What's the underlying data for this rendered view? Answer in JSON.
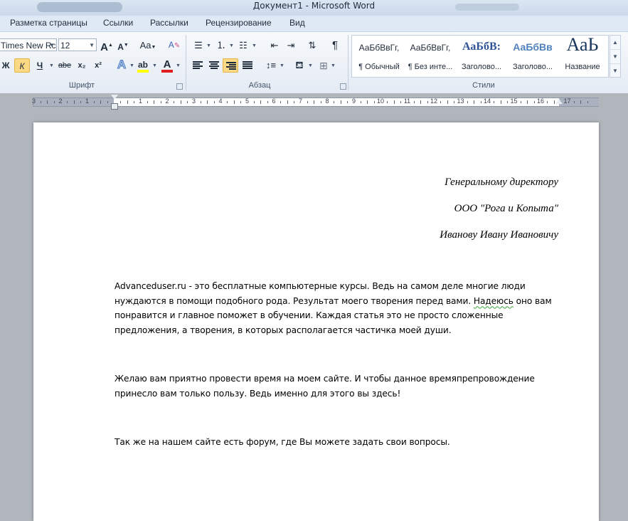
{
  "window": {
    "title": "Документ1  -  Microsoft Word"
  },
  "tabs": [
    "Разметка страницы",
    "Ссылки",
    "Рассылки",
    "Рецензирование",
    "Вид"
  ],
  "ribbon": {
    "font_group": {
      "label": "Шрифт",
      "font_name": "Times New Rc",
      "font_size": "12",
      "grow_label": "A",
      "shrink_label": "A",
      "case_label": "Aa",
      "bold_label": "Ж",
      "italic_label": "К",
      "underline_label": "Ч",
      "strike_label": "abe",
      "subscript_label": "x₂",
      "superscript_label": "x²",
      "effects_label": "A",
      "highlight_label": "ab",
      "font_color_label": "A",
      "highlight_color": "#ffff00",
      "font_color": "#e02020"
    },
    "paragraph_group": {
      "label": "Абзац"
    },
    "styles_group": {
      "label": "Стили",
      "items": [
        {
          "sample": "АаБбВвГг,",
          "name": "¶ Обычный"
        },
        {
          "sample": "АаБбВвГг,",
          "name": "¶ Без инте..."
        },
        {
          "sample": "АаБбВ:",
          "name": "Заголово..."
        },
        {
          "sample": "АаБбВв",
          "name": "Заголово..."
        },
        {
          "sample": "АаЬ",
          "name": "Название"
        }
      ]
    }
  },
  "ruler": {
    "numbers": [
      "3",
      "2",
      "1",
      "1",
      "2",
      "3",
      "4",
      "5",
      "6",
      "7",
      "8",
      "9",
      "10",
      "11",
      "12",
      "13",
      "14",
      "15",
      "16",
      "17"
    ]
  },
  "document": {
    "address": [
      "Генеральному директору",
      "ООО \"Рога и Копыта\"",
      "Иванову Ивану Ивановичу"
    ],
    "para1_before": "Advanceduser.ru - это бесплатные компьютерные курсы. Ведь на самом деле многие люди нуждаются в помощи подобного рода. Результат моего творения перед вами. ",
    "para1_mark": "Надеюсь",
    "para1_after": " оно вам понравится и главное поможет в обучении. Каждая статья это не просто сложенные предложения, а творения, в которых располагается частичка моей души.",
    "para2": " Желаю вам приятно провести время на моем сайте. И чтобы данное времяпрепровождение принесло вам только пользу. Ведь именно для этого вы здесь!",
    "para3": " Так же на  нашем сайте есть форум,  где Вы можете задать свои вопросы."
  }
}
